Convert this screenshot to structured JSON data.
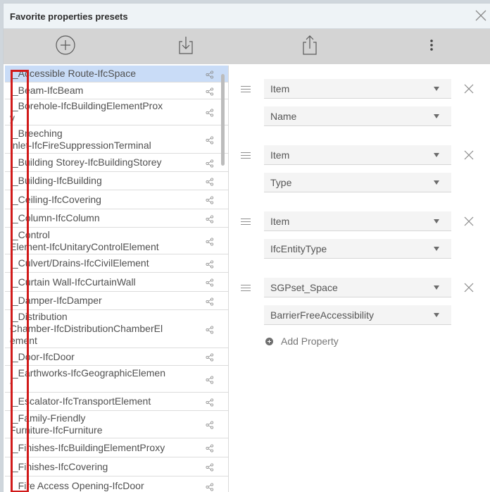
{
  "dialog": {
    "title": "Favorite properties presets"
  },
  "toolbar": {
    "add_icon": "plus-circle-icon",
    "import_icon": "download-icon",
    "export_icon": "share-upload-icon",
    "more_icon": "more-vertical-icon"
  },
  "presets": [
    {
      "label": "I_Accessible Route-IfcSpace",
      "selected": true
    },
    {
      "label": "I_Beam-IfcBeam"
    },
    {
      "label": "I_Borehole-IfcBuildingElementProx\ny"
    },
    {
      "label": "I_Breeching\nInlet-IfcFireSuppressionTerminal"
    },
    {
      "label": "I_Building Storey-IfcBuildingStorey"
    },
    {
      "label": "I_Building-IfcBuilding"
    },
    {
      "label": "I_Ceiling-IfcCovering"
    },
    {
      "label": "I_Column-IfcColumn"
    },
    {
      "label": "I_Control\nElement-IfcUnitaryControlElement"
    },
    {
      "label": "I_Culvert/Drains-IfcCivilElement"
    },
    {
      "label": "I_Curtain Wall-IfcCurtainWall"
    },
    {
      "label": "I_Damper-IfcDamper"
    },
    {
      "label": "I_Distribution\nChamber-IfcDistributionChamberEl\nement"
    },
    {
      "label": "I_Door-IfcDoor"
    },
    {
      "label": "I_Earthworks-IfcGeographicElemen\nt"
    },
    {
      "label": "I_Escalator-IfcTransportElement"
    },
    {
      "label": "I_Family-Friendly\nFurniture-IfcFurniture"
    },
    {
      "label": "I_Finishes-IfcBuildingElementProxy"
    },
    {
      "label": "I_Finishes-IfcCovering"
    },
    {
      "label": "I_Fire Access Opening-IfcDoor"
    }
  ],
  "properties": [
    {
      "group": "Item",
      "value": "Name"
    },
    {
      "group": "Item",
      "value": "Type"
    },
    {
      "group": "Item",
      "value": "IfcEntityType"
    },
    {
      "group": "SGPset_Space",
      "value": "BarrierFreeAccessibility"
    }
  ],
  "add_property_label": "Add Property",
  "colors": {
    "selected_row": "#c9dcf7",
    "toolbar": "#d4d4d4",
    "highlight": "#d11a1a"
  }
}
